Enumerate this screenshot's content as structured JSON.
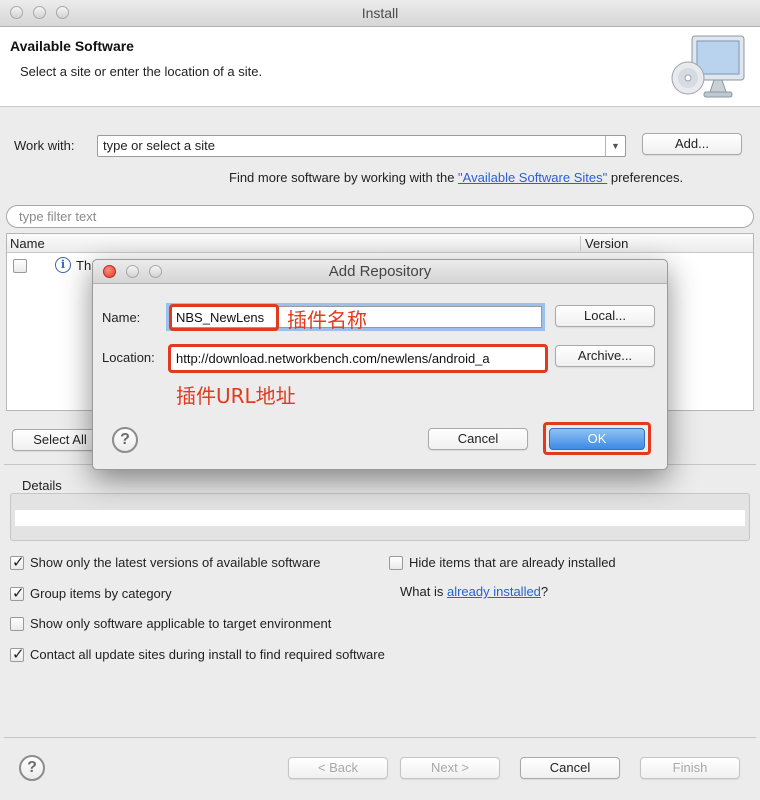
{
  "window": {
    "title": "Install"
  },
  "banner": {
    "heading": "Available Software",
    "subtitle": "Select a site or enter the location of a site."
  },
  "work_with": {
    "label": "Work with:",
    "value": "type or select a site",
    "add_button": "Add..."
  },
  "find_more": {
    "prefix": "Find more software by working with the ",
    "link": "\"Available Software Sites\"",
    "suffix": " preferences."
  },
  "filter": {
    "placeholder": "type filter text"
  },
  "table": {
    "col_name": "Name",
    "col_version": "Version",
    "row1_text": "Th"
  },
  "select_all_button": "Select All",
  "details": {
    "label": "Details"
  },
  "options": {
    "show_latest": "Show only the latest versions of available software",
    "hide_installed": "Hide items that are already installed",
    "group_by_category": "Group items by category",
    "what_is_prefix": "What is ",
    "already_installed_link": "already installed",
    "what_is_suffix": "?",
    "show_applicable": "Show only software applicable to target environment",
    "contact_sites": "Contact all update sites during install to find required software"
  },
  "checkbox_states": {
    "show_latest": true,
    "hide_installed": false,
    "group_by_category": true,
    "show_applicable": false,
    "contact_sites": true
  },
  "footer": {
    "back": "< Back",
    "next": "Next >",
    "cancel": "Cancel",
    "finish": "Finish"
  },
  "dialog": {
    "title": "Add Repository",
    "name_label": "Name:",
    "name_value": "NBS_NewLens",
    "name_annotation": "插件名称",
    "local_button": "Local...",
    "location_label": "Location:",
    "location_value": "http://download.networkbench.com/newlens/android_a",
    "location_annotation": "插件URL地址",
    "archive_button": "Archive...",
    "cancel_button": "Cancel",
    "ok_button": "OK"
  },
  "colors": {
    "annotation_red": "#e23a1e",
    "link_blue": "#2a5fd8",
    "ok_blue": "#3d8ae5"
  }
}
